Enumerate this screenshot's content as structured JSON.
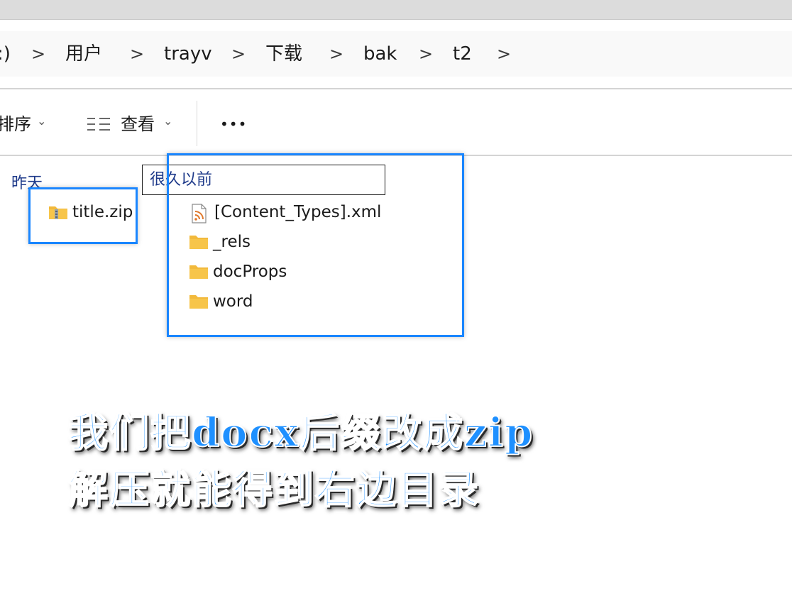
{
  "breadcrumb": {
    "partial": ":)",
    "items": [
      "用户",
      "trayv",
      "下载",
      "bak",
      "t2"
    ],
    "separator": ">"
  },
  "toolbar": {
    "sort_label": "排序",
    "view_label": "查看",
    "more_label": "•••",
    "chevron": "⌄"
  },
  "groups": {
    "left_label": "昨天",
    "right_label": "很久以前"
  },
  "left_files": [
    {
      "name": "title.zip",
      "icon": "zip-folder-icon"
    }
  ],
  "right_files": [
    {
      "name": "[Content_Types].xml",
      "icon": "rss-xml-file-icon"
    },
    {
      "name": "_rels",
      "icon": "folder-icon"
    },
    {
      "name": "docProps",
      "icon": "folder-icon"
    },
    {
      "name": "word",
      "icon": "folder-icon"
    }
  ],
  "caption": {
    "line1": "我们把docx后缀改成zip",
    "line2": "解压就能得到右边目录"
  },
  "colors": {
    "highlight": "#1a86ff",
    "caption": "#1e90ff",
    "folder": "#f7c54a",
    "group_label": "#1e3a8a"
  }
}
